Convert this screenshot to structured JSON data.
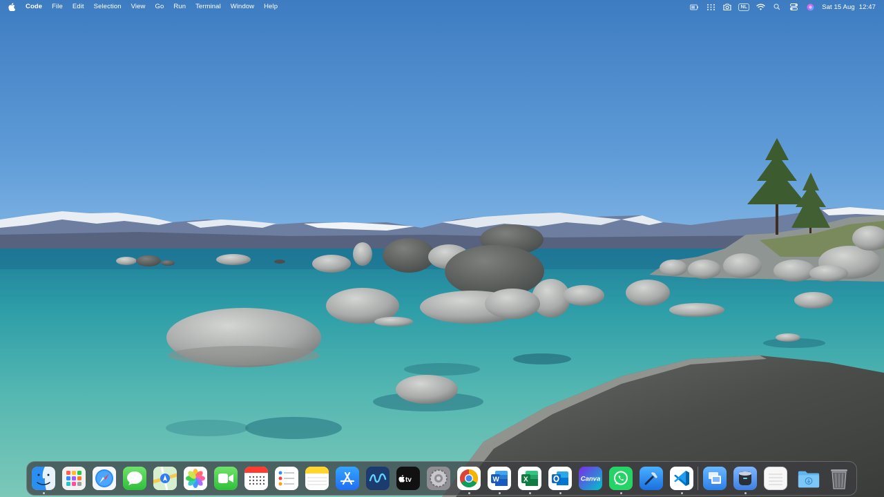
{
  "menubar": {
    "app_name": "Code",
    "menus": [
      "File",
      "Edit",
      "Selection",
      "View",
      "Go",
      "Run",
      "Terminal",
      "Window",
      "Help"
    ],
    "status_icons": [
      "battery-icon",
      "grid-icon",
      "camera-icon",
      "input-source-icon",
      "wifi-icon",
      "search-icon",
      "control-center-icon",
      "siri-icon"
    ],
    "input_source": "NL",
    "date": "Sat 15 Aug",
    "time": "12:47"
  },
  "dock": {
    "apps": [
      {
        "name": "Finder",
        "icon": "finder-icon",
        "running": true
      },
      {
        "name": "Launchpad",
        "icon": "launchpad-icon",
        "running": false
      },
      {
        "name": "Safari",
        "icon": "safari-icon",
        "running": false
      },
      {
        "name": "Messages",
        "icon": "messages-icon",
        "running": false
      },
      {
        "name": "Maps",
        "icon": "maps-icon",
        "running": false
      },
      {
        "name": "Photos",
        "icon": "photos-icon",
        "running": false
      },
      {
        "name": "FaceTime",
        "icon": "facetime-icon",
        "running": false
      },
      {
        "name": "Calendar",
        "icon": "calendar-icon",
        "running": false
      },
      {
        "name": "Reminders",
        "icon": "reminders-icon",
        "running": false
      },
      {
        "name": "Notes",
        "icon": "notes-icon",
        "running": false
      },
      {
        "name": "App Store",
        "icon": "app-store-icon",
        "running": false
      },
      {
        "name": "Freeform",
        "icon": "freeform-icon",
        "running": false
      },
      {
        "name": "TV",
        "icon": "apple-tv-icon",
        "label": "tv",
        "running": false
      },
      {
        "name": "System Settings",
        "icon": "settings-icon",
        "running": false
      },
      {
        "name": "Google Chrome",
        "icon": "chrome-icon",
        "running": true
      },
      {
        "name": "Microsoft Word",
        "icon": "word-icon",
        "label": "W",
        "running": true
      },
      {
        "name": "Microsoft Excel",
        "icon": "excel-icon",
        "label": "X",
        "running": true
      },
      {
        "name": "Microsoft Outlook",
        "icon": "outlook-icon",
        "running": true
      },
      {
        "name": "Canva",
        "icon": "canva-icon",
        "label": "Canva",
        "running": false
      },
      {
        "name": "WhatsApp",
        "icon": "whatsapp-icon",
        "running": true
      },
      {
        "name": "Xcode",
        "icon": "xcode-icon",
        "running": false
      },
      {
        "name": "Visual Studio Code",
        "icon": "vscode-icon",
        "running": true
      },
      {
        "name": "Preview",
        "icon": "preview-icon",
        "running": false
      },
      {
        "name": "Disk Utility",
        "icon": "disk-utility-icon",
        "running": true
      },
      {
        "name": "Document",
        "icon": "document-icon",
        "running": false
      },
      {
        "name": "Downloads",
        "icon": "downloads-folder-icon",
        "running": false
      },
      {
        "name": "Trash",
        "icon": "trash-icon",
        "running": false
      }
    ]
  }
}
